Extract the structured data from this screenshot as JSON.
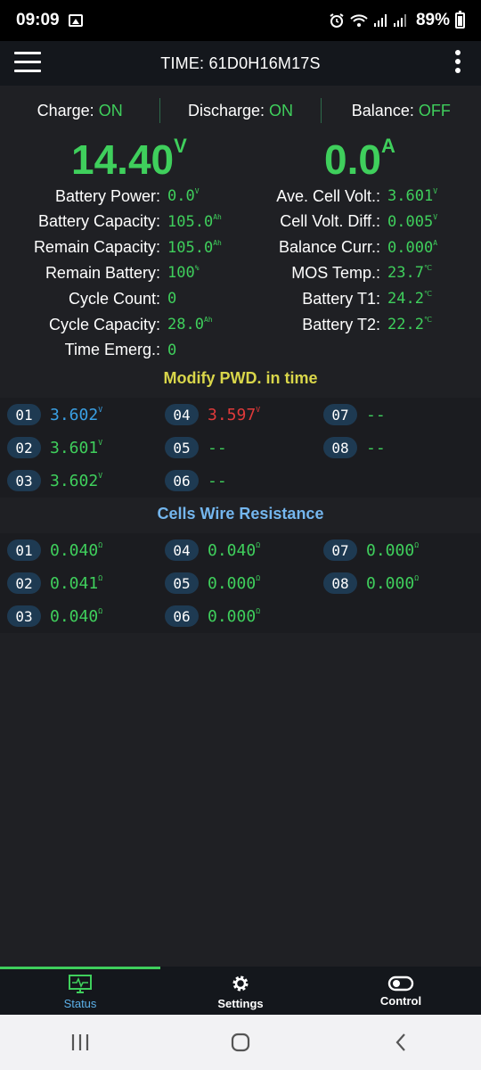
{
  "status_bar": {
    "time": "09:09",
    "battery_percent": "89%",
    "icons": [
      "gallery-icon",
      "alarm-icon",
      "wifi-icon",
      "signal-icon",
      "signal-icon",
      "battery-icon"
    ]
  },
  "app_bar": {
    "title": "TIME: 61D0H16M17S",
    "menu_icon": "menu-icon",
    "more_icon": "more-vertical-icon"
  },
  "switches": {
    "charge": {
      "label": "Charge: ",
      "value": "ON"
    },
    "discharge": {
      "label": "Discharge: ",
      "value": "ON"
    },
    "balance": {
      "label": "Balance: ",
      "value": "OFF"
    }
  },
  "main": {
    "voltage": {
      "value": "14.40",
      "unit": "V"
    },
    "current": {
      "value": "0.0",
      "unit": "A"
    }
  },
  "left_stats": [
    {
      "label": "Battery Power:",
      "value": "0.0",
      "unit": "V"
    },
    {
      "label": "Battery Capacity:",
      "value": "105.0",
      "unit": "Ah"
    },
    {
      "label": "Remain Capacity:",
      "value": "105.0",
      "unit": "Ah"
    },
    {
      "label": "Remain Battery:",
      "value": "100",
      "unit": "%"
    },
    {
      "label": "Cycle Count:",
      "value": "0",
      "unit": ""
    },
    {
      "label": "Cycle Capacity:",
      "value": "28.0",
      "unit": "Ah"
    },
    {
      "label": "Time Emerg.:",
      "value": "0",
      "unit": ""
    }
  ],
  "right_stats": [
    {
      "label": "Ave. Cell Volt.:",
      "value": "3.601",
      "unit": "V"
    },
    {
      "label": "Cell Volt. Diff.:",
      "value": "0.005",
      "unit": "V"
    },
    {
      "label": "Balance Curr.:",
      "value": "0.000",
      "unit": "A"
    },
    {
      "label": "MOS Temp.:",
      "value": "23.7",
      "unit": "℃"
    },
    {
      "label": "Battery T1:",
      "value": "24.2",
      "unit": "℃"
    },
    {
      "label": "Battery T2:",
      "value": "22.2",
      "unit": "℃"
    }
  ],
  "cell_voltage_section": {
    "title": "Modify PWD. in time",
    "cells": [
      {
        "num": "01",
        "value": "3.602",
        "unit": "V",
        "color": "#3aa0e4"
      },
      {
        "num": "02",
        "value": "3.601",
        "unit": "V",
        "color": "#3fcf5c"
      },
      {
        "num": "03",
        "value": "3.602",
        "unit": "V",
        "color": "#3fcf5c"
      },
      {
        "num": "04",
        "value": "3.597",
        "unit": "V",
        "color": "#e03a3a"
      },
      {
        "num": "05",
        "value": "--",
        "unit": "",
        "color": "#3fcf5c"
      },
      {
        "num": "06",
        "value": "--",
        "unit": "",
        "color": "#3fcf5c"
      },
      {
        "num": "07",
        "value": "--",
        "unit": "",
        "color": "#3fcf5c"
      },
      {
        "num": "08",
        "value": "--",
        "unit": "",
        "color": "#3fcf5c"
      }
    ]
  },
  "wire_resistance_section": {
    "title": "Cells Wire Resistance",
    "cells": [
      {
        "num": "01",
        "value": "0.040",
        "unit": "Ω"
      },
      {
        "num": "02",
        "value": "0.041",
        "unit": "Ω"
      },
      {
        "num": "03",
        "value": "0.040",
        "unit": "Ω"
      },
      {
        "num": "04",
        "value": "0.040",
        "unit": "Ω"
      },
      {
        "num": "05",
        "value": "0.000",
        "unit": "Ω"
      },
      {
        "num": "06",
        "value": "0.000",
        "unit": "Ω"
      },
      {
        "num": "07",
        "value": "0.000",
        "unit": "Ω"
      },
      {
        "num": "08",
        "value": "0.000",
        "unit": "Ω"
      }
    ]
  },
  "bottom_nav": [
    {
      "label": "Status",
      "icon": "monitor-icon",
      "active": true
    },
    {
      "label": "Settings",
      "icon": "gear-icon",
      "active": false
    },
    {
      "label": "Control",
      "icon": "toggle-icon",
      "active": false
    }
  ],
  "accent_colors": {
    "green": "#3fcf5c",
    "yellow_title": "#d9d64a",
    "blue_title": "#74b6ee",
    "background": "#1f2024"
  }
}
